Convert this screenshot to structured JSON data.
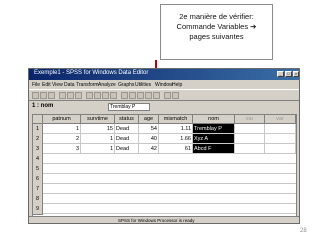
{
  "callout": {
    "line1": "2e manière de vérifier:",
    "line2": "Commande Variables ➔",
    "line3": "pages suivantes"
  },
  "window": {
    "title": "Exemple1 - SPSS for Windows Data Editor",
    "menu": [
      "File",
      "Edit",
      "View",
      "Data",
      "Transform",
      "Analyze",
      "Graphs",
      "Utilities",
      "Window",
      "Help"
    ],
    "status": "SPSS for Windows Processor is ready"
  },
  "cell_editor": {
    "ref": "1 : nom",
    "value": "Tremblay P"
  },
  "table": {
    "columns": [
      "patnum",
      "survtime",
      "status",
      "age",
      "mismatch",
      "nom",
      "var",
      "var"
    ],
    "rows": [
      {
        "num": "1",
        "cells": [
          "1",
          "15",
          "Dead",
          "54",
          "1.11",
          "Tremblay P",
          "",
          ""
        ]
      },
      {
        "num": "2",
        "cells": [
          "2",
          "1",
          "Dead",
          "40",
          "1.66",
          "Xyz A",
          "",
          ""
        ]
      },
      {
        "num": "3",
        "cells": [
          "3",
          "1",
          "Dead",
          "42",
          "61",
          "Abcd F",
          "",
          ""
        ]
      },
      {
        "num": "4",
        "cells": [
          "",
          "",
          "",
          "",
          "",
          "",
          "",
          ""
        ]
      },
      {
        "num": "5",
        "cells": [
          "",
          "",
          "",
          "",
          "",
          "",
          "",
          ""
        ]
      },
      {
        "num": "6",
        "cells": [
          "",
          "",
          "",
          "",
          "",
          "",
          "",
          ""
        ]
      },
      {
        "num": "7",
        "cells": [
          "",
          "",
          "",
          "",
          "",
          "",
          "",
          ""
        ]
      },
      {
        "num": "8",
        "cells": [
          "",
          "",
          "",
          "",
          "",
          "",
          "",
          ""
        ]
      },
      {
        "num": "9",
        "cells": [
          "",
          "",
          "",
          "",
          "",
          "",
          "",
          ""
        ]
      }
    ]
  },
  "page_number": "28",
  "colors": {
    "arrow": "#c00000",
    "titlebar": "#0a246a",
    "selection": "#000000"
  }
}
